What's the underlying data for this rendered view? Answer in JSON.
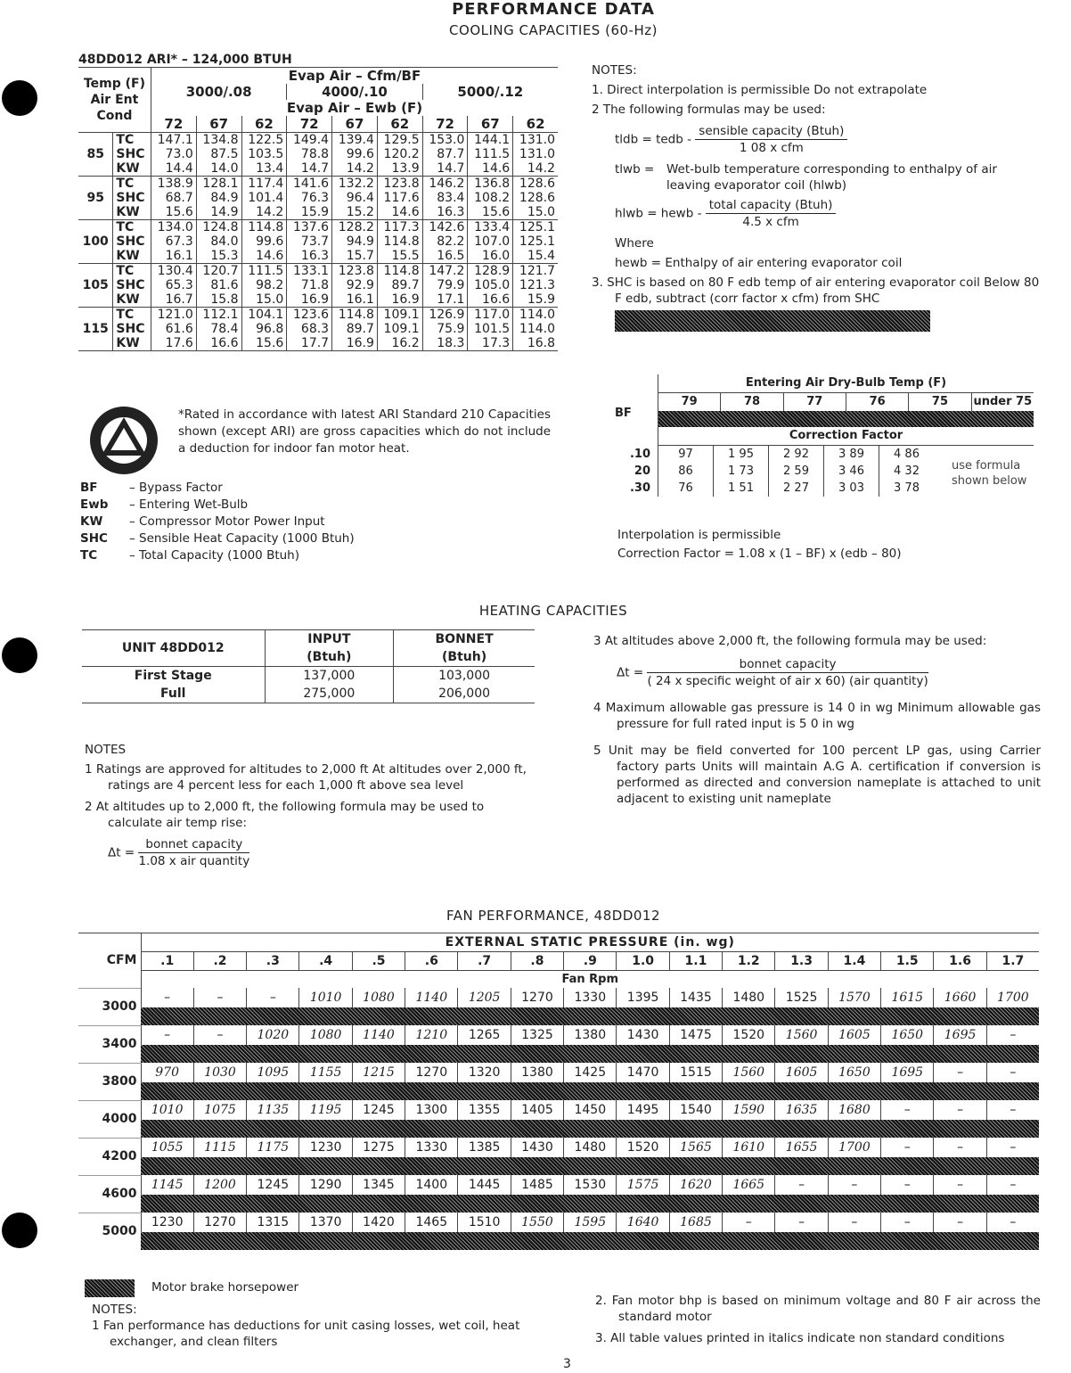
{
  "title": "PERFORMANCE DATA",
  "cooling": {
    "title": "COOLING CAPACITIES (60-Hz)",
    "unit": "48DD012  ARI* – 124,000 BTUH",
    "row_header": [
      "Temp (F)",
      "Air Ent",
      "Cond"
    ],
    "evap_cfm_label": "Evap Air – Cfm/BF",
    "cfm_groups": [
      "3000/.08",
      "4000/.10",
      "5000/.12"
    ],
    "evap_ewb_label": "Evap Air – Ewb (F)",
    "ewb": [
      "72",
      "67",
      "62",
      "72",
      "67",
      "62",
      "72",
      "67",
      "62"
    ],
    "rows": [
      {
        "temp": "85",
        "TC": [
          "147.1",
          "134.8",
          "122.5",
          "149.4",
          "139.4",
          "129.5",
          "153.0",
          "144.1",
          "131.0"
        ],
        "SHC": [
          "73.0",
          "87.5",
          "103.5",
          "78.8",
          "99.6",
          "120.2",
          "87.7",
          "111.5",
          "131.0"
        ],
        "KW": [
          "14.4",
          "14.0",
          "13.4",
          "14.7",
          "14.2",
          "13.9",
          "14.7",
          "14.6",
          "14.2"
        ]
      },
      {
        "temp": "95",
        "TC": [
          "138.9",
          "128.1",
          "117.4",
          "141.6",
          "132.2",
          "123.8",
          "146.2",
          "136.8",
          "128.6"
        ],
        "SHC": [
          "68.7",
          "84.9",
          "101.4",
          "76.3",
          "96.4",
          "117.6",
          "83.4",
          "108.2",
          "128.6"
        ],
        "KW": [
          "15.6",
          "14.9",
          "14.2",
          "15.9",
          "15.2",
          "14.6",
          "16.3",
          "15.6",
          "15.0"
        ]
      },
      {
        "temp": "100",
        "TC": [
          "134.0",
          "124.8",
          "114.8",
          "137.6",
          "128.2",
          "117.3",
          "142.6",
          "133.4",
          "125.1"
        ],
        "SHC": [
          "67.3",
          "84.0",
          "99.6",
          "73.7",
          "94.9",
          "114.8",
          "82.2",
          "107.0",
          "125.1"
        ],
        "KW": [
          "16.1",
          "15.3",
          "14.6",
          "16.3",
          "15.7",
          "15.5",
          "16.5",
          "16.0",
          "15.4"
        ]
      },
      {
        "temp": "105",
        "TC": [
          "130.4",
          "120.7",
          "111.5",
          "133.1",
          "123.8",
          "114.8",
          "147.2",
          "128.9",
          "121.7"
        ],
        "SHC": [
          "65.3",
          "81.6",
          "98.2",
          "71.8",
          "92.9",
          "89.7",
          "79.9",
          "105.0",
          "121.3"
        ],
        "KW": [
          "16.7",
          "15.8",
          "15.0",
          "16.9",
          "16.1",
          "16.9",
          "17.1",
          "16.6",
          "15.9"
        ]
      },
      {
        "temp": "115",
        "TC": [
          "121.0",
          "112.1",
          "104.1",
          "123.6",
          "114.8",
          "109.1",
          "126.9",
          "117.0",
          "114.0"
        ],
        "SHC": [
          "61.6",
          "78.4",
          "96.8",
          "68.3",
          "89.7",
          "109.1",
          "75.9",
          "101.5",
          "114.0"
        ],
        "KW": [
          "17.6",
          "16.6",
          "15.6",
          "17.7",
          "16.9",
          "16.2",
          "18.3",
          "17.3",
          "16.8"
        ]
      }
    ],
    "rated_note": "*Rated in accordance with latest ARI Standard 210 Capacities shown (except ARI) are gross capacities which do not include a deduction for indoor fan motor heat.",
    "legend": [
      {
        "k": "BF",
        "v": "– Bypass Factor"
      },
      {
        "k": "Ewb",
        "v": "– Entering Wet-Bulb"
      },
      {
        "k": "KW",
        "v": "– Compressor Motor Power Input"
      },
      {
        "k": "SHC",
        "v": "– Sensible Heat Capacity (1000 Btuh)"
      },
      {
        "k": "TC",
        "v": "– Total Capacity (1000 Btuh)"
      }
    ],
    "notes": {
      "heading": "NOTES:",
      "n1": "1.  Direct interpolation is permissible  Do not extrapolate",
      "n2": "2   The following formulas may be used:",
      "f1_lhs": "tldb = tedb -",
      "f1_num": "sensible capacity (Btuh)",
      "f1_den": "1 08 x cfm",
      "f2_lhs": "tlwb =",
      "f2_text": "Wet-bulb temperature corresponding to enthalpy of air leaving evaporator coil (hlwb)",
      "f3_lhs": "hlwb = hewb -",
      "f3_num": "total capacity (Btuh)",
      "f3_den": "4.5 x cfm",
      "where": "Where",
      "hewb": "hewb = Enthalpy of air entering evaporator coil",
      "n3": "3.  SHC is based on 80 F edb temp of air entering evaporator coil Below 80 F edb, subtract (corr factor x cfm) from SHC"
    },
    "correction": {
      "title": "Entering Air Dry-Bulb Temp (F)",
      "bf": "BF",
      "temps": [
        "79",
        "78",
        "77",
        "76",
        "75",
        "under 75"
      ],
      "factor_label": "Correction Factor",
      "rows": [
        {
          "bf": ".10",
          "v": [
            "97",
            "1 95",
            "2 92",
            "3 89",
            "4 86"
          ]
        },
        {
          "bf": "20",
          "v": [
            "86",
            "1 73",
            "2 59",
            "3 46",
            "4 32"
          ]
        },
        {
          "bf": ".30",
          "v": [
            "76",
            "1 51",
            "2 27",
            "3 03",
            "3 78"
          ]
        }
      ],
      "formula_note": "use formula shown below",
      "interp": "Interpolation is permissible",
      "formula": "Correction Factor  =  1.08  x  (1 – BF)  x  (edb – 80)"
    }
  },
  "heating": {
    "title": "HEATING CAPACITIES",
    "unit": "UNIT 48DD012",
    "col_input": "INPUT",
    "col_input_unit": "(Btuh)",
    "col_bonnet": "BONNET",
    "col_bonnet_unit": "(Btuh)",
    "rows": [
      {
        "stage": "First Stage",
        "input": "137,000",
        "bonnet": "103,000"
      },
      {
        "stage": "Full",
        "input": "275,000",
        "bonnet": "206,000"
      }
    ],
    "notes_heading": "NOTES",
    "n1": "1   Ratings are approved for altitudes to 2,000 ft  At altitudes over 2,000 ft, ratings are 4 percent less for each 1,000 ft above sea level",
    "n2": "2   At altitudes up to 2,000 ft, the following formula may be used to calculate air temp rise:",
    "f1_lhs": "Δt =",
    "f1_num": "bonnet capacity",
    "f1_den": "1.08 x air quantity",
    "n3": "3   At altitudes above 2,000 ft, the following formula may be used:",
    "f2_lhs": "Δt =",
    "f2_num": "bonnet capacity",
    "f2_den": "( 24 x specific weight of air x 60) (air quantity)",
    "n4": "4   Maximum allowable gas pressure is 14 0 in wg  Minimum allowable gas pressure for full rated input is 5 0 in  wg",
    "n5": "5   Unit may be field converted for 100 percent LP gas, using Carrier factory parts  Units will maintain A.G A. certification if conversion is performed as directed and conversion nameplate is attached to unit adjacent to existing unit nameplate"
  },
  "fan": {
    "title": "FAN PERFORMANCE, 48DD012",
    "cfm_label": "CFM",
    "esp_label": "EXTERNAL STATIC PRESSURE (in. wg)",
    "esp": [
      ".1",
      ".2",
      ".3",
      ".4",
      ".5",
      ".6",
      ".7",
      ".8",
      ".9",
      "1.0",
      "1.1",
      "1.2",
      "1.3",
      "1.4",
      "1.5",
      "1.6",
      "1.7"
    ],
    "rpm_label": "Fan Rpm",
    "rows": [
      {
        "cfm": "3000",
        "v": [
          "–",
          "–",
          "–",
          "1010",
          "1080",
          "1140",
          "1205",
          "1270",
          "1330",
          "1395",
          "1435",
          "1480",
          "1525",
          "1570",
          "1615",
          "1660",
          "1700"
        ],
        "italic": [
          3,
          4,
          5,
          6,
          13,
          14,
          15,
          16
        ]
      },
      {
        "cfm": "3400",
        "v": [
          "–",
          "–",
          "1020",
          "1080",
          "1140",
          "1210",
          "1265",
          "1325",
          "1380",
          "1430",
          "1475",
          "1520",
          "1560",
          "1605",
          "1650",
          "1695",
          "–"
        ],
        "italic": [
          2,
          3,
          4,
          5,
          12,
          13,
          14,
          15
        ]
      },
      {
        "cfm": "3800",
        "v": [
          "970",
          "1030",
          "1095",
          "1155",
          "1215",
          "1270",
          "1320",
          "1380",
          "1425",
          "1470",
          "1515",
          "1560",
          "1605",
          "1650",
          "1695",
          "–",
          "–"
        ],
        "italic": [
          0,
          1,
          2,
          3,
          4,
          11,
          12,
          13,
          14
        ]
      },
      {
        "cfm": "4000",
        "v": [
          "1010",
          "1075",
          "1135",
          "1195",
          "1245",
          "1300",
          "1355",
          "1405",
          "1450",
          "1495",
          "1540",
          "1590",
          "1635",
          "1680",
          "–",
          "–",
          "–"
        ],
        "italic": [
          0,
          1,
          2,
          3,
          11,
          12,
          13
        ]
      },
      {
        "cfm": "4200",
        "v": [
          "1055",
          "1115",
          "1175",
          "1230",
          "1275",
          "1330",
          "1385",
          "1430",
          "1480",
          "1520",
          "1565",
          "1610",
          "1655",
          "1700",
          "–",
          "–",
          "–"
        ],
        "italic": [
          0,
          1,
          2,
          10,
          11,
          12,
          13
        ]
      },
      {
        "cfm": "4600",
        "v": [
          "1145",
          "1200",
          "1245",
          "1290",
          "1345",
          "1400",
          "1445",
          "1485",
          "1530",
          "1575",
          "1620",
          "1665",
          "–",
          "–",
          "–",
          "–",
          "–"
        ],
        "italic": [
          0,
          1,
          9,
          10,
          11
        ]
      },
      {
        "cfm": "5000",
        "v": [
          "1230",
          "1270",
          "1315",
          "1370",
          "1420",
          "1465",
          "1510",
          "1550",
          "1595",
          "1640",
          "1685",
          "–",
          "–",
          "–",
          "–",
          "–",
          "–"
        ],
        "italic": [
          7,
          8,
          9,
          10
        ]
      }
    ],
    "legend": "Motor brake horsepower",
    "notes_heading": "NOTES:",
    "n1": "1   Fan performance has deductions for unit casing losses, wet coil, heat exchanger, and clean filters",
    "n2": "2.  Fan motor bhp is based on minimum voltage and 80 F air across the standard motor",
    "n3": "3.  All table values printed in italics indicate non standard conditions"
  },
  "page_number": "3"
}
